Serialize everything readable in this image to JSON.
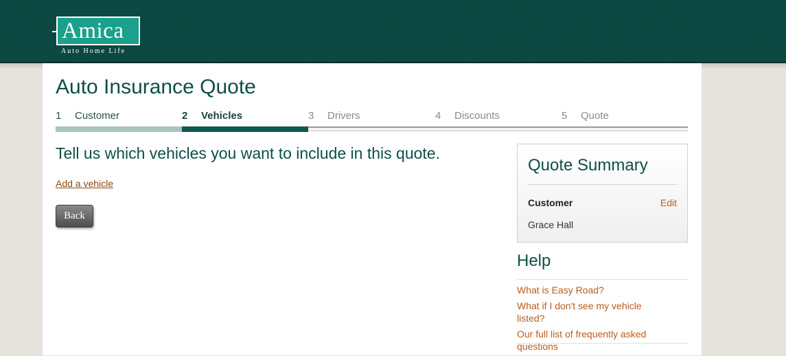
{
  "brand": {
    "logo_text": "Amica",
    "tagline": "Auto Home Life"
  },
  "page": {
    "title": "Auto Insurance Quote"
  },
  "steps": [
    {
      "num": "1",
      "label": "Customer",
      "state": "done"
    },
    {
      "num": "2",
      "label": "Vehicles",
      "state": "active"
    },
    {
      "num": "3",
      "label": "Drivers",
      "state": "upcoming"
    },
    {
      "num": "4",
      "label": "Discounts",
      "state": "upcoming"
    },
    {
      "num": "5",
      "label": "Quote",
      "state": "upcoming"
    }
  ],
  "main": {
    "lead": "Tell us which vehicles you want to include in this quote.",
    "add_vehicle": "Add a vehicle",
    "back": "Back"
  },
  "summary": {
    "title": "Quote Summary",
    "customer_label": "Customer",
    "edit": "Edit",
    "customer_name": "Grace Hall"
  },
  "help": {
    "title": "Help",
    "links": [
      "What is Easy Road?",
      "What if I don't see my vehicle listed?",
      "Our full list of frequently asked questions"
    ]
  },
  "colors": {
    "header": "#0d4c44",
    "accent": "#0d5a50",
    "link": "#b85c1c"
  }
}
